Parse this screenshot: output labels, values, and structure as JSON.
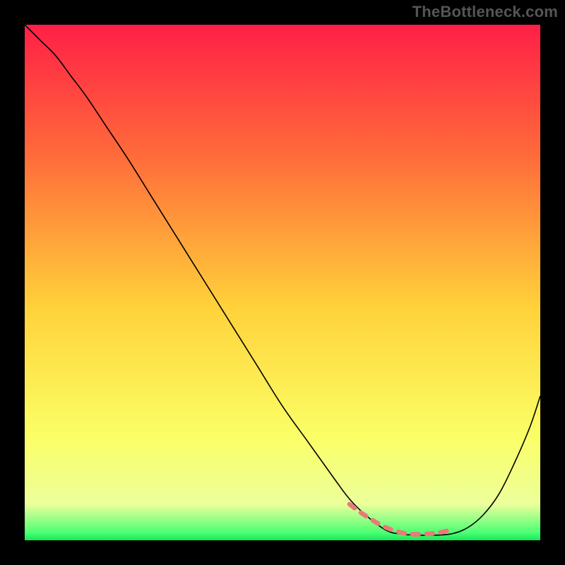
{
  "watermark": "TheBottleneck.com",
  "chart_data": {
    "type": "line",
    "title": "",
    "xlabel": "",
    "ylabel": "",
    "xlim": [
      0,
      100
    ],
    "ylim": [
      0,
      100
    ],
    "grid": false,
    "legend": false,
    "background_gradient": {
      "stops": [
        {
          "offset": 0.0,
          "color": "#ff1f47"
        },
        {
          "offset": 0.25,
          "color": "#ff6a3a"
        },
        {
          "offset": 0.55,
          "color": "#ffd23a"
        },
        {
          "offset": 0.8,
          "color": "#fbff66"
        },
        {
          "offset": 0.93,
          "color": "#ecff9b"
        },
        {
          "offset": 0.985,
          "color": "#4dff74"
        },
        {
          "offset": 1.0,
          "color": "#14e858"
        }
      ]
    },
    "series": [
      {
        "name": "bottleneck-curve",
        "color": "#000000",
        "width": 1.6,
        "x": [
          0,
          3,
          6,
          9,
          12,
          16,
          20,
          25,
          30,
          35,
          40,
          45,
          50,
          55,
          60,
          63,
          66,
          70,
          73,
          76,
          80,
          83,
          86,
          89,
          92,
          95,
          98,
          100
        ],
        "values": [
          100,
          97,
          94,
          90,
          86,
          80,
          74,
          66,
          58,
          50,
          42,
          34,
          26,
          19,
          12,
          8,
          5,
          2,
          1.2,
          1.0,
          1.0,
          1.3,
          2.5,
          5,
          9,
          15,
          22,
          28
        ]
      },
      {
        "name": "optimal-range-highlight",
        "color": "#e97a78",
        "width": 6.5,
        "x": [
          63,
          65,
          67,
          69,
          71,
          73,
          75,
          77,
          79,
          81,
          83
        ],
        "values": [
          7.0,
          5.5,
          4.2,
          3.0,
          2.1,
          1.5,
          1.2,
          1.2,
          1.3,
          1.6,
          2.2
        ]
      }
    ]
  }
}
